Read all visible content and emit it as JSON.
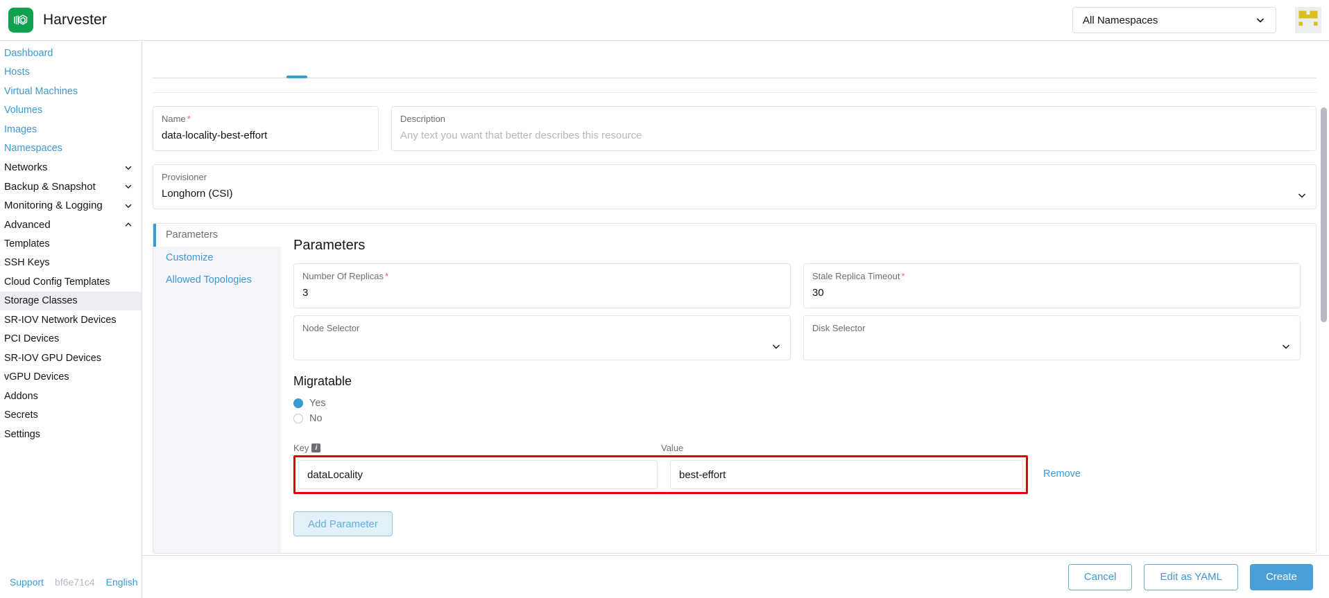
{
  "header": {
    "brand": "Harvester",
    "logo_icon": "harvester-logo-icon",
    "namespace_selector": {
      "value": "All Namespaces",
      "chevron_icon": "chevron-down-icon"
    },
    "avatar_icon": "user-avatar-identicon"
  },
  "sidebar": {
    "items": [
      {
        "label": "Dashboard",
        "type": "link",
        "active": false
      },
      {
        "label": "Hosts",
        "type": "link",
        "active": false
      },
      {
        "label": "Virtual Machines",
        "type": "link",
        "active": false
      },
      {
        "label": "Volumes",
        "type": "link",
        "active": false
      },
      {
        "label": "Images",
        "type": "link",
        "active": false
      },
      {
        "label": "Namespaces",
        "type": "link",
        "active": false
      },
      {
        "label": "Networks",
        "type": "group",
        "expanded": false
      },
      {
        "label": "Backup & Snapshot",
        "type": "group",
        "expanded": false
      },
      {
        "label": "Monitoring & Logging",
        "type": "group",
        "expanded": false
      },
      {
        "label": "Advanced",
        "type": "group",
        "expanded": true
      },
      {
        "label": "Templates",
        "type": "child",
        "active": false
      },
      {
        "label": "SSH Keys",
        "type": "child",
        "active": false
      },
      {
        "label": "Cloud Config Templates",
        "type": "child",
        "active": false
      },
      {
        "label": "Storage Classes",
        "type": "child",
        "active": true
      },
      {
        "label": "SR-IOV Network Devices",
        "type": "child",
        "active": false
      },
      {
        "label": "PCI Devices",
        "type": "child",
        "active": false
      },
      {
        "label": "SR-IOV GPU Devices",
        "type": "child",
        "active": false
      },
      {
        "label": "vGPU Devices",
        "type": "child",
        "active": false
      },
      {
        "label": "Addons",
        "type": "child",
        "active": false
      },
      {
        "label": "Secrets",
        "type": "child",
        "active": false
      },
      {
        "label": "Settings",
        "type": "child",
        "active": false
      }
    ],
    "footer": {
      "support": "Support",
      "version": "bf6e71c4",
      "language": "English"
    }
  },
  "form": {
    "name": {
      "label": "Name",
      "required": true,
      "value": "data-locality-best-effort"
    },
    "description": {
      "label": "Description",
      "required": false,
      "value": "",
      "placeholder": "Any text you want that better describes this resource"
    },
    "provisioner": {
      "label": "Provisioner",
      "value": "Longhorn (CSI)",
      "chevron_icon": "chevron-down-icon"
    }
  },
  "panel": {
    "tabs": [
      {
        "label": "Parameters",
        "active": true
      },
      {
        "label": "Customize",
        "active": false
      },
      {
        "label": "Allowed Topologies",
        "active": false
      }
    ],
    "title": "Parameters",
    "fields": {
      "number_of_replicas": {
        "label": "Number Of Replicas",
        "required": true,
        "value": "3"
      },
      "stale_replica_timeout": {
        "label": "Stale Replica Timeout",
        "required": true,
        "value": "30"
      },
      "node_selector": {
        "label": "Node Selector",
        "value": "",
        "chevron_icon": "chevron-down-icon"
      },
      "disk_selector": {
        "label": "Disk Selector",
        "value": "",
        "chevron_icon": "chevron-down-icon"
      }
    },
    "migratable": {
      "title": "Migratable",
      "options": [
        {
          "label": "Yes",
          "selected": true
        },
        {
          "label": "No",
          "selected": false
        }
      ]
    },
    "kv": {
      "key_header": "Key",
      "key_info_icon": "info-icon",
      "value_header": "Value",
      "rows": [
        {
          "key": "dataLocality",
          "value": "best-effort",
          "remove_label": "Remove"
        }
      ],
      "add_button": "Add Parameter"
    }
  },
  "footer_actions": {
    "cancel": "Cancel",
    "edit_yaml": "Edit as YAML",
    "create": "Create"
  },
  "colors": {
    "brand_green": "#0fa14e",
    "accent_blue": "#3d98d3",
    "primary_button": "#4b9fd8",
    "highlight_red": "#e30000",
    "required_red": "#f25c5c",
    "avatar_yellow": "#d8c020"
  }
}
